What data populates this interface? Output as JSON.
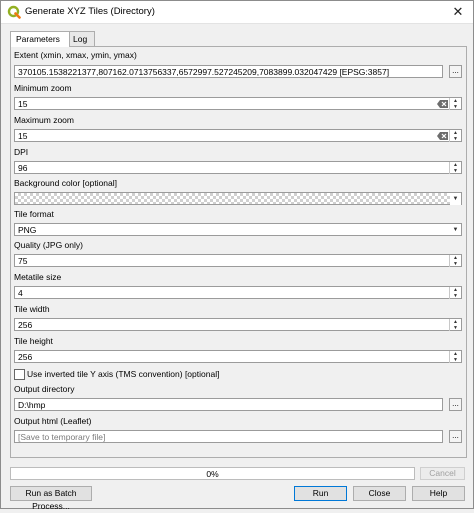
{
  "window": {
    "title": "Generate XYZ Tiles (Directory)",
    "close_glyph": "✕"
  },
  "tabs": [
    {
      "label": "Parameters"
    },
    {
      "label": "Log"
    }
  ],
  "params": {
    "extent_label": "Extent (xmin, xmax, ymin, ymax)",
    "extent_value": "370105.1538221377,807162.0713756337,6572997.527245209,7083899.032047429 [EPSG:3857]",
    "min_zoom_label": "Minimum zoom",
    "min_zoom_value": "15",
    "max_zoom_label": "Maximum zoom",
    "max_zoom_value": "15",
    "dpi_label": "DPI",
    "dpi_value": "96",
    "bg_label": "Background color [optional]",
    "tile_format_label": "Tile format",
    "tile_format_value": "PNG",
    "quality_label": "Quality (JPG only)",
    "quality_value": "75",
    "metatile_label": "Metatile size",
    "metatile_value": "4",
    "tile_width_label": "Tile width",
    "tile_width_value": "256",
    "tile_height_label": "Tile height",
    "tile_height_value": "256",
    "inverted_label": "Use inverted tile Y axis (TMS convention) [optional]",
    "inverted_checked": false,
    "output_dir_label": "Output directory",
    "output_dir_value": "D:\\hmp",
    "output_html_label": "Output html (Leaflet)",
    "output_html_placeholder": "[Save to temporary file]",
    "browse_glyph": "..."
  },
  "progress": {
    "text": "0%",
    "value": 0
  },
  "buttons": {
    "cancel": "Cancel",
    "batch": "Run as Batch Process...",
    "run": "Run",
    "close": "Close",
    "help": "Help"
  }
}
